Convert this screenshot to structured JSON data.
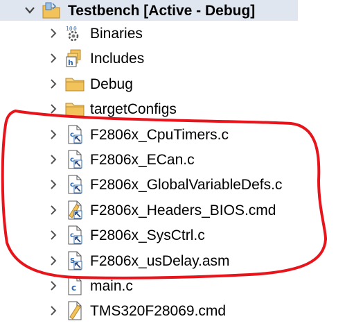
{
  "project": {
    "label": "Testbench  [Active - Debug]",
    "icon": "project-folder-icon",
    "expanded": true
  },
  "items": [
    {
      "label": "Binaries",
      "icon": "binaries-icon"
    },
    {
      "label": "Includes",
      "icon": "includes-icon"
    },
    {
      "label": "Debug",
      "icon": "folder-icon"
    },
    {
      "label": "targetConfigs",
      "icon": "folder-icon"
    },
    {
      "label": "F2806x_CpuTimers.c",
      "icon": "linked-c-file-icon"
    },
    {
      "label": "F2806x_ECan.c",
      "icon": "linked-c-file-icon"
    },
    {
      "label": "F2806x_GlobalVariableDefs.c",
      "icon": "linked-c-file-icon"
    },
    {
      "label": "F2806x_Headers_BIOS.cmd",
      "icon": "linked-cmd-file-icon"
    },
    {
      "label": "F2806x_SysCtrl.c",
      "icon": "linked-c-file-icon"
    },
    {
      "label": "F2806x_usDelay.asm",
      "icon": "linked-asm-file-icon"
    },
    {
      "label": "main.c",
      "icon": "c-file-icon"
    },
    {
      "label": "TMS320F28069.cmd",
      "icon": "cmd-file-icon"
    }
  ],
  "colors": {
    "selection": "#dfe6f0",
    "annotation": "#e8141b",
    "folder": "#f2c25b",
    "file_blue": "#2f6db5"
  }
}
